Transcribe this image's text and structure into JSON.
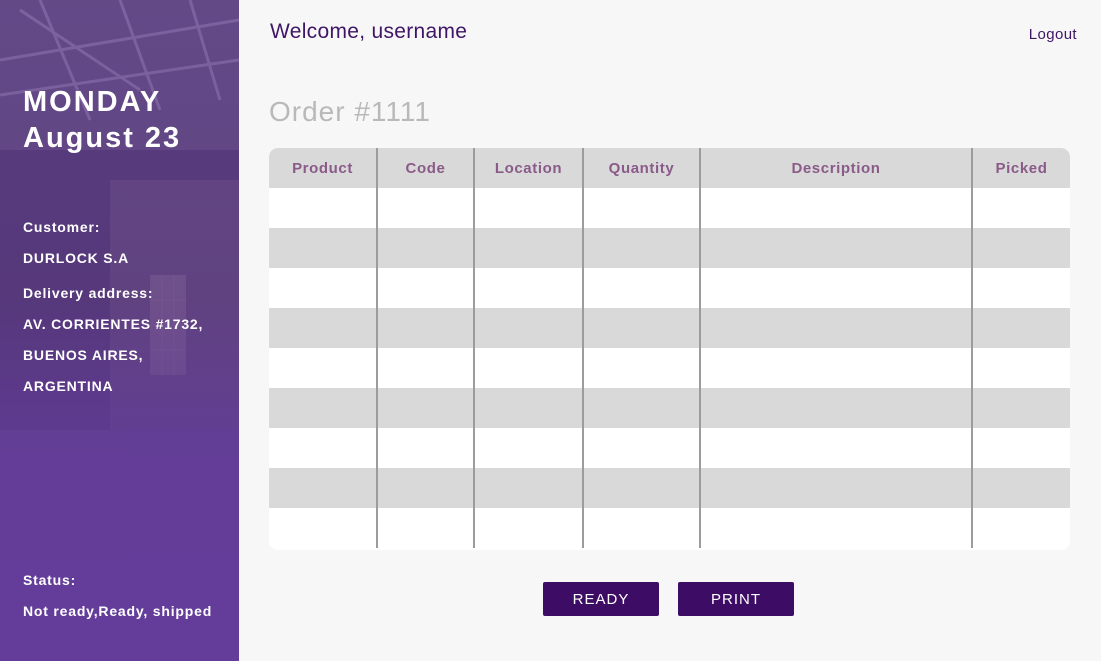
{
  "header": {
    "welcome": "Welcome, username",
    "logout_label": "Logout"
  },
  "sidebar": {
    "day": "MONDAY",
    "date": "August 23",
    "customer_label": "Customer:",
    "customer_value": "DURLOCK S.A",
    "delivery_label": "Delivery address:",
    "address_lines": [
      "AV. CORRIENTES #1732,",
      "BUENOS AIRES,",
      "ARGENTINA"
    ],
    "status_label": "Status:",
    "status_value": "Not ready,Ready, shipped"
  },
  "order": {
    "title": "Order #1111"
  },
  "table": {
    "columns": [
      "Product",
      "Code",
      "Location",
      "Quantity",
      "Description",
      "Picked"
    ],
    "rows": [
      [
        "",
        "",
        "",
        "",
        "",
        ""
      ],
      [
        "",
        "",
        "",
        "",
        "",
        ""
      ],
      [
        "",
        "",
        "",
        "",
        "",
        ""
      ],
      [
        "",
        "",
        "",
        "",
        "",
        ""
      ],
      [
        "",
        "",
        "",
        "",
        "",
        ""
      ],
      [
        "",
        "",
        "",
        "",
        "",
        ""
      ],
      [
        "",
        "",
        "",
        "",
        "",
        ""
      ],
      [
        "",
        "",
        "",
        "",
        "",
        ""
      ],
      [
        "",
        "",
        "",
        "",
        "",
        ""
      ]
    ]
  },
  "actions": {
    "ready_label": "READY",
    "print_label": "PRINT"
  },
  "colors": {
    "accent": "#3d0c64",
    "sidebar": "#5a3590",
    "header_text": "#8a5a88",
    "row_stripe": "#d9d9d9"
  }
}
